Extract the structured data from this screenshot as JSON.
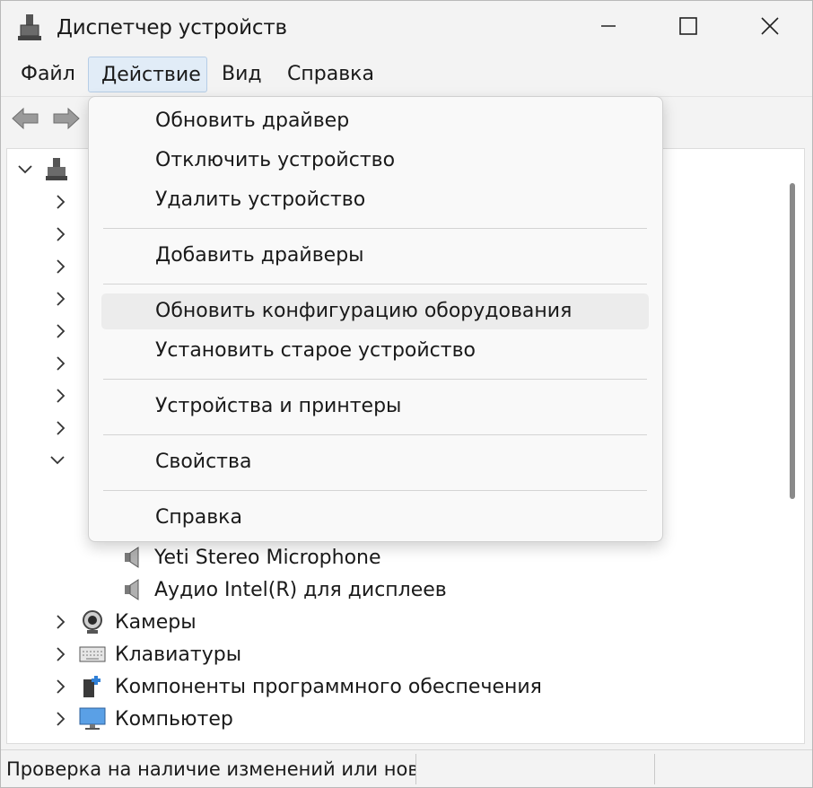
{
  "window": {
    "title": "Диспетчер устройств",
    "icon": "device-manager-icon",
    "controls": [
      "minimize-icon",
      "maximize-icon",
      "close-icon"
    ]
  },
  "menubar": {
    "items": [
      {
        "label": "Файл"
      },
      {
        "label": "Действие",
        "active": true
      },
      {
        "label": "Вид"
      },
      {
        "label": "Справка"
      }
    ]
  },
  "toolbar": {
    "buttons": [
      "back-arrow-icon",
      "forward-arrow-icon"
    ]
  },
  "action_menu": {
    "groups": [
      [
        "Обновить драйвер",
        "Отключить устройство",
        "Удалить устройство"
      ],
      [
        "Добавить драйверы"
      ],
      [
        "Обновить конфигурацию оборудования",
        "Установить старое устройство"
      ],
      [
        "Устройства и принтеры"
      ],
      [
        "Свойства"
      ],
      [
        "Справка"
      ]
    ],
    "highlighted": "Обновить конфигурацию оборудования"
  },
  "tree": {
    "visible_items": [
      {
        "label": "Yeti Stereo Microphone",
        "icon": "speaker-icon",
        "expander": "none"
      },
      {
        "label": "Аудио Intel(R) для дисплеев",
        "icon": "speaker-icon",
        "expander": "none"
      },
      {
        "label": "Камеры",
        "icon": "camera-icon",
        "expander": "collapsed"
      },
      {
        "label": "Клавиатуры",
        "icon": "keyboard-icon",
        "expander": "collapsed"
      },
      {
        "label": "Компоненты программного обеспечения",
        "icon": "software-component-icon",
        "expander": "collapsed"
      },
      {
        "label": "Компьютер",
        "icon": "monitor-icon",
        "expander": "collapsed"
      }
    ]
  },
  "statusbar": {
    "text": "Проверка на наличие изменений или нов"
  },
  "colors": {
    "window_bg": "#f3f3f3",
    "menu_active_bg": "#e1ecf7",
    "menu_active_border": "#b6cde6",
    "dropdown_bg": "#f9f9f9",
    "hover_bg": "#ececec"
  }
}
